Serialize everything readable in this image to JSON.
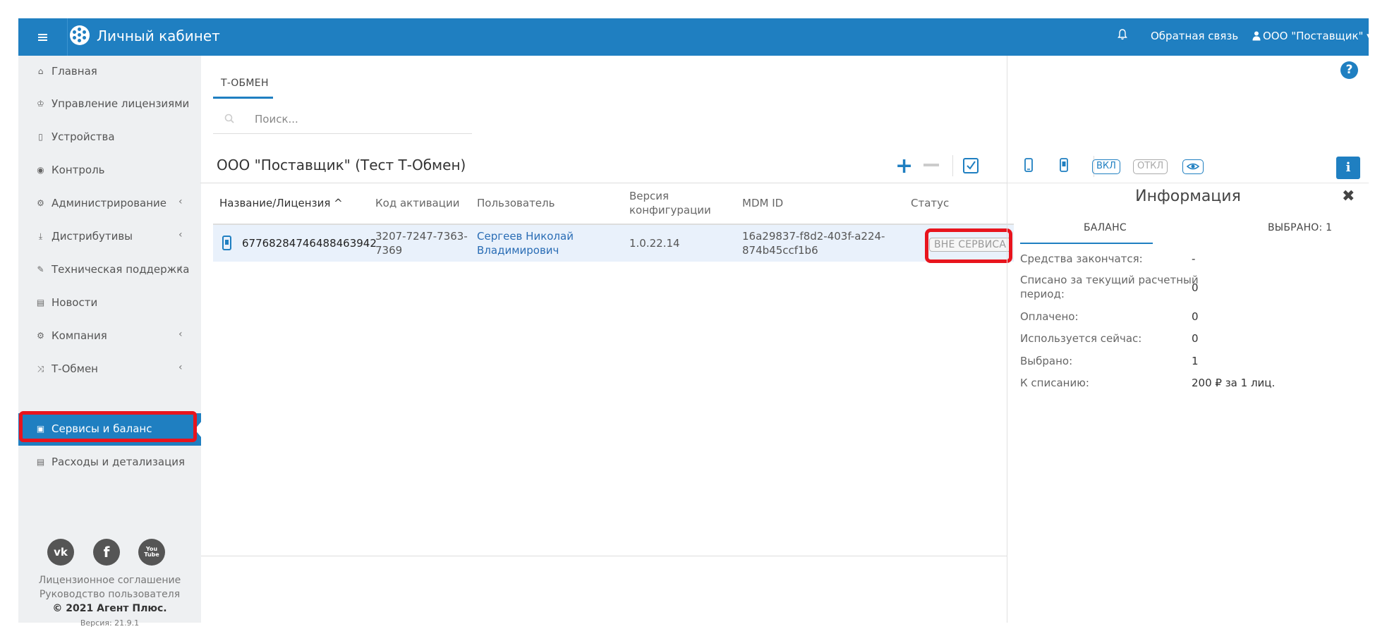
{
  "header": {
    "app_title": "Личный кабинет",
    "feedback": "Обратная связь",
    "account": "ООО \"Поставщик\" ▾"
  },
  "sidebar": {
    "items": [
      {
        "label": "Главная",
        "icon": "⌂",
        "chev": ""
      },
      {
        "label": "Управление лицензиями",
        "icon": "♔",
        "chev": "‹"
      },
      {
        "label": "Устройства",
        "icon": "▯",
        "chev": ""
      },
      {
        "label": "Контроль",
        "icon": "◉",
        "chev": ""
      },
      {
        "label": "Администрирование",
        "icon": "⚙",
        "chev": "‹"
      },
      {
        "label": "Дистрибутивы",
        "icon": "⤓",
        "chev": "‹"
      },
      {
        "label": "Техническая поддержка",
        "icon": "✎",
        "chev": "‹"
      },
      {
        "label": "Новости",
        "icon": "▤",
        "chev": ""
      },
      {
        "label": "Компания",
        "icon": "⚙",
        "chev": "‹"
      },
      {
        "label": "Т-Обмен",
        "icon": "⤨",
        "chev": "‹"
      },
      {
        "label": "Сервисы и баланс",
        "icon": "▣",
        "chev": ""
      },
      {
        "label": "Расходы и детализация",
        "icon": "▤",
        "chev": ""
      }
    ],
    "social": {
      "vk": "vk",
      "fb": "f",
      "yt": "You Tube"
    },
    "footer": {
      "license": "Лицензионное соглашение",
      "manual": "Руководство пользователя",
      "copyright": "© 2021 Агент Плюс.",
      "version": "Версия: 21.9.1"
    }
  },
  "main": {
    "tab": "Т-ОБМЕН",
    "search_placeholder": "Поиск...",
    "org_title": "ООО \"Поставщик\" (Тест Т-Обмен)",
    "columns": {
      "name": "Название/Лицензия ^",
      "code": "Код активации",
      "user": "Пользователь",
      "version_1": "Версия",
      "version_2": "конфигурации",
      "mdm": "MDM ID",
      "status": "Статус"
    },
    "row": {
      "name": "67768284746488463942",
      "code_1": "3207-7247-7363-",
      "code_2": "7369",
      "user_1": "Сергеев Николай",
      "user_2": "Владимирович",
      "version": "1.0.22.14",
      "mdm_1": "16a29837-f8d2-403f-a224-",
      "mdm_2": "874b45ccf1b6",
      "status": "ВНЕ СЕРВИСА"
    }
  },
  "panel": {
    "btn_on": "ВКЛ",
    "btn_off": "ОТКЛ",
    "title": "Информация",
    "tab_balance": "БАЛАНС",
    "tab_selected": "ВЫБРАНО: 1",
    "rows": [
      {
        "k1": "Средства закончатся:",
        "k2": "",
        "v": "-"
      },
      {
        "k1": "Списано за текущий расчетный",
        "k2": "период:",
        "v": "0"
      },
      {
        "k1": "Оплачено:",
        "k2": "",
        "v": "0"
      },
      {
        "k1": "Используется сейчас:",
        "k2": "",
        "v": "0"
      },
      {
        "k1": "Выбрано:",
        "k2": "",
        "v": "1"
      },
      {
        "k1": "К списанию:",
        "k2": "",
        "v": "200 ₽ за 1 лиц."
      }
    ]
  }
}
